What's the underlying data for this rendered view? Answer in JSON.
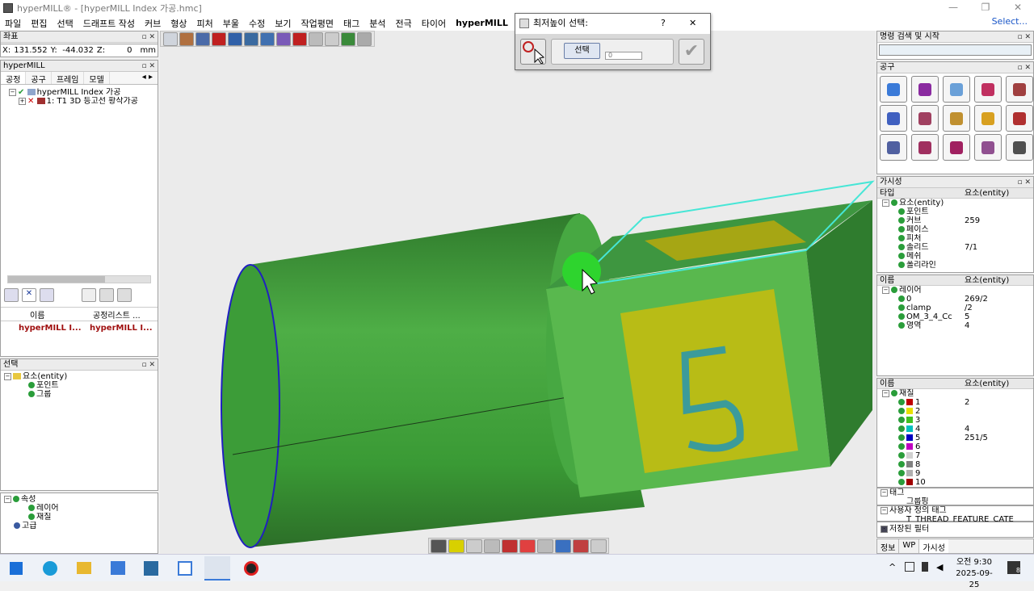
{
  "window": {
    "title": "hyperMILL® - [hyperMILL Index 가공.hmc]"
  },
  "menu": {
    "items": [
      "파일",
      "편집",
      "선택",
      "드래프트 작성",
      "커브",
      "형상",
      "피처",
      "부울",
      "수정",
      "보기",
      "작업평면",
      "태그",
      "분석",
      "전극",
      "타이어",
      "hyperMILL"
    ],
    "select_label": "Select..."
  },
  "coord": {
    "x_label": "X:",
    "x": "131.552",
    "y_label": "Y:",
    "y": "-44.032",
    "z_label": "Z:",
    "z": "0",
    "unit": "mm",
    "title": "좌표"
  },
  "hm_panel": {
    "title": "hyperMILL",
    "tabs": [
      "공정",
      "공구",
      "프레임",
      "모델"
    ],
    "tree": [
      "hyperMILL Index 가공",
      "1: T1 3D 등고선 황삭가공"
    ],
    "cols": [
      "이름",
      "공정리스트 ..."
    ],
    "row": [
      "hyperMILL I...",
      "hyperMILL I..."
    ]
  },
  "select_panel": {
    "title": "선택",
    "tree": [
      "요소(entity)",
      "포인트",
      "그룹"
    ]
  },
  "attr_panel": {
    "tree": [
      "속성",
      "레이어",
      "재질",
      "고급"
    ]
  },
  "dialog": {
    "title": "최저높이 선택:",
    "help": "?",
    "close": "✕",
    "select_btn": "선택",
    "value": "0"
  },
  "right": {
    "search_title": "명령 검색 및 시작",
    "tools_title": "공구",
    "vis_title": "가시성",
    "vis_cols": [
      "타입",
      "요소(entity)"
    ],
    "vis_rows": [
      [
        "요소(entity)",
        ""
      ],
      [
        "포인트",
        ""
      ],
      [
        "커브",
        "259"
      ],
      [
        "페이스",
        ""
      ],
      [
        "피처",
        ""
      ],
      [
        "솔리드",
        "7/1"
      ],
      [
        "메쉬",
        ""
      ],
      [
        "폴리라인",
        ""
      ]
    ],
    "layer_cols": [
      "이름",
      "요소(entity)"
    ],
    "layer_rows": [
      [
        "레이어",
        ""
      ],
      [
        "0",
        "269/2"
      ],
      [
        "clamp",
        "/2"
      ],
      [
        "OM_3_4_Cc",
        "5"
      ],
      [
        "영역",
        "4"
      ]
    ],
    "mat_cols": [
      "이름",
      "요소(entity)"
    ],
    "mat_rows": [
      [
        "재질",
        ""
      ],
      [
        "1",
        "2"
      ],
      [
        "2",
        ""
      ],
      [
        "3",
        ""
      ],
      [
        "4",
        "4"
      ],
      [
        "5",
        "251/5"
      ],
      [
        "6",
        ""
      ],
      [
        "7",
        ""
      ],
      [
        "8",
        ""
      ],
      [
        "9",
        ""
      ],
      [
        "10",
        ""
      ]
    ],
    "mat_colors": [
      "#c00000",
      "#e8e000",
      "#40c020",
      "#00c0c0",
      "#0000c0",
      "#c000c0",
      "#d0d0d0",
      "#808080",
      "#b0b0b0",
      "#a00000"
    ],
    "tag_rows": [
      "태그",
      "그룹핑"
    ],
    "user_tag_rows": [
      "사용자 정의 태그",
      "T_THREAD_FEATURE_CATE"
    ],
    "saved_filter": "저장된 필터",
    "bottom_tabs": [
      "정보",
      "WP",
      "가시성"
    ]
  },
  "taskbar": {
    "time": "오전 9:30",
    "date": "2025-09-25",
    "notif": "8"
  },
  "model": {
    "digit": "5",
    "color_body": "#4caf50",
    "color_face": "#c8c800"
  }
}
